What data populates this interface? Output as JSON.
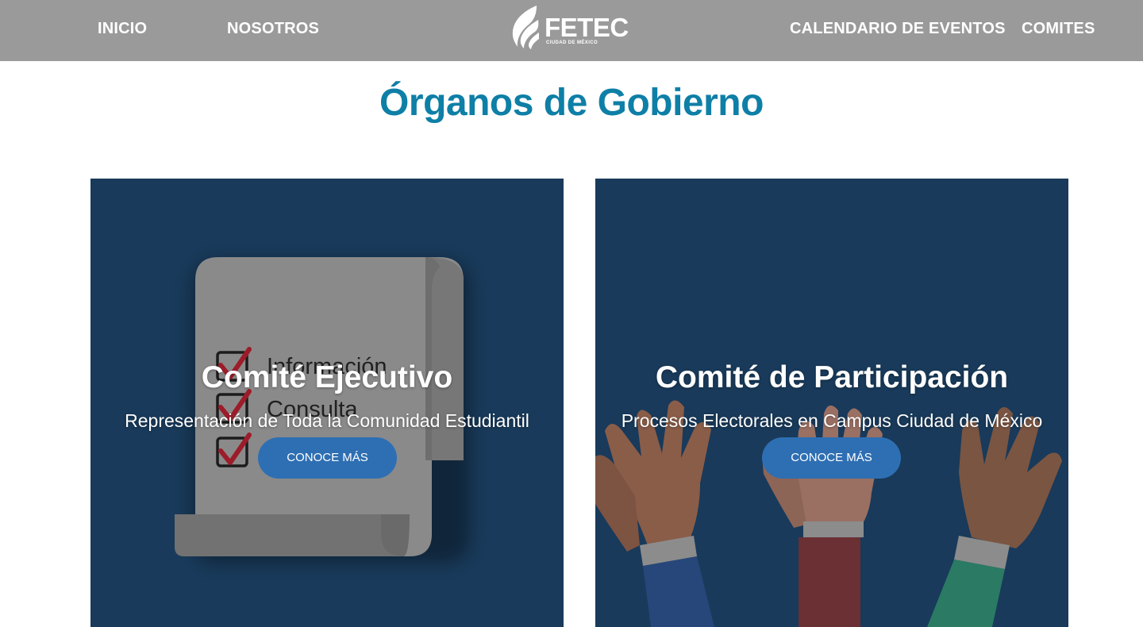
{
  "nav": {
    "left_items": [
      {
        "label": "INICIO"
      },
      {
        "label": "NOSOTROS"
      }
    ],
    "right_items": [
      {
        "label": "CALENDARIO DE EVENTOS"
      },
      {
        "label": "COMITES"
      }
    ],
    "logo": {
      "text": "FETEC",
      "subtext": "CIUDAD DE MÉXICO"
    }
  },
  "page": {
    "title": "Órganos de Gobierno"
  },
  "cards": [
    {
      "title": "Comité Ejecutivo",
      "subtitle": "Representación de Toda la Comunidad Estudiantil",
      "button_label": "CONOCE MÁS",
      "art_text": [
        "Información",
        "Consulta"
      ]
    },
    {
      "title": "Comité de Participación",
      "subtitle": "Procesos Electorales en Campus Ciudad de México",
      "button_label": "CONOCE MÁS"
    }
  ],
  "colors": {
    "topbar": "#9a9a9a",
    "title": "#0e7fa6",
    "card_bg": "#193a5a",
    "button": "#2e6fb3"
  }
}
